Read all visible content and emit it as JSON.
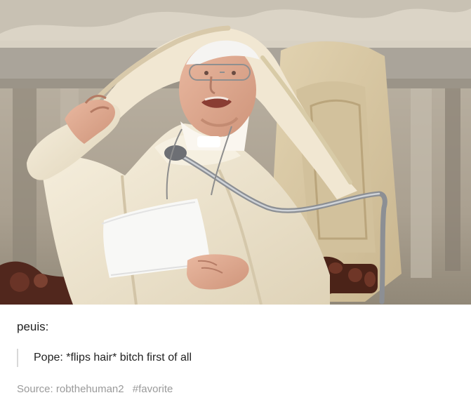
{
  "post": {
    "image_alt": "Pope in white robes holding up the hood with one hand while speaking into a microphone",
    "username": "peuis",
    "username_suffix": ":",
    "quote": "Pope: *flips hair* bitch first of all",
    "source_label": "Source:",
    "source_name": "robthehuman2",
    "tag": "#favorite"
  },
  "colors": {
    "text": "#222222",
    "meta": "#9a9a9a",
    "quote_rule": "#d8d8d8",
    "robe": "#efe6d1",
    "chair": "#d8c7a2"
  }
}
